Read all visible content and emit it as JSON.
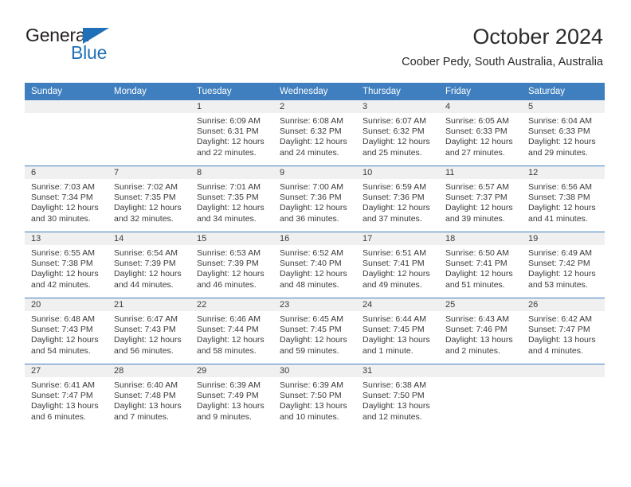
{
  "brand": {
    "name_top": "General",
    "name_bottom": "Blue",
    "accent_color": "#1f70b8"
  },
  "header": {
    "month_title": "October 2024",
    "location": "Coober Pedy, South Australia, Australia"
  },
  "calendar": {
    "header_bg": "#3f7fbf",
    "weekday_headers": [
      "Sunday",
      "Monday",
      "Tuesday",
      "Wednesday",
      "Thursday",
      "Friday",
      "Saturday"
    ],
    "weeks": [
      [
        {
          "day": "",
          "blank": true,
          "sunrise": "",
          "sunset": "",
          "daylight1": "",
          "daylight2": ""
        },
        {
          "day": "",
          "blank": true,
          "sunrise": "",
          "sunset": "",
          "daylight1": "",
          "daylight2": ""
        },
        {
          "day": "1",
          "blank": false,
          "sunrise": "Sunrise: 6:09 AM",
          "sunset": "Sunset: 6:31 PM",
          "daylight1": "Daylight: 12 hours",
          "daylight2": "and 22 minutes."
        },
        {
          "day": "2",
          "blank": false,
          "sunrise": "Sunrise: 6:08 AM",
          "sunset": "Sunset: 6:32 PM",
          "daylight1": "Daylight: 12 hours",
          "daylight2": "and 24 minutes."
        },
        {
          "day": "3",
          "blank": false,
          "sunrise": "Sunrise: 6:07 AM",
          "sunset": "Sunset: 6:32 PM",
          "daylight1": "Daylight: 12 hours",
          "daylight2": "and 25 minutes."
        },
        {
          "day": "4",
          "blank": false,
          "sunrise": "Sunrise: 6:05 AM",
          "sunset": "Sunset: 6:33 PM",
          "daylight1": "Daylight: 12 hours",
          "daylight2": "and 27 minutes."
        },
        {
          "day": "5",
          "blank": false,
          "sunrise": "Sunrise: 6:04 AM",
          "sunset": "Sunset: 6:33 PM",
          "daylight1": "Daylight: 12 hours",
          "daylight2": "and 29 minutes."
        }
      ],
      [
        {
          "day": "6",
          "blank": false,
          "sunrise": "Sunrise: 7:03 AM",
          "sunset": "Sunset: 7:34 PM",
          "daylight1": "Daylight: 12 hours",
          "daylight2": "and 30 minutes."
        },
        {
          "day": "7",
          "blank": false,
          "sunrise": "Sunrise: 7:02 AM",
          "sunset": "Sunset: 7:35 PM",
          "daylight1": "Daylight: 12 hours",
          "daylight2": "and 32 minutes."
        },
        {
          "day": "8",
          "blank": false,
          "sunrise": "Sunrise: 7:01 AM",
          "sunset": "Sunset: 7:35 PM",
          "daylight1": "Daylight: 12 hours",
          "daylight2": "and 34 minutes."
        },
        {
          "day": "9",
          "blank": false,
          "sunrise": "Sunrise: 7:00 AM",
          "sunset": "Sunset: 7:36 PM",
          "daylight1": "Daylight: 12 hours",
          "daylight2": "and 36 minutes."
        },
        {
          "day": "10",
          "blank": false,
          "sunrise": "Sunrise: 6:59 AM",
          "sunset": "Sunset: 7:36 PM",
          "daylight1": "Daylight: 12 hours",
          "daylight2": "and 37 minutes."
        },
        {
          "day": "11",
          "blank": false,
          "sunrise": "Sunrise: 6:57 AM",
          "sunset": "Sunset: 7:37 PM",
          "daylight1": "Daylight: 12 hours",
          "daylight2": "and 39 minutes."
        },
        {
          "day": "12",
          "blank": false,
          "sunrise": "Sunrise: 6:56 AM",
          "sunset": "Sunset: 7:38 PM",
          "daylight1": "Daylight: 12 hours",
          "daylight2": "and 41 minutes."
        }
      ],
      [
        {
          "day": "13",
          "blank": false,
          "sunrise": "Sunrise: 6:55 AM",
          "sunset": "Sunset: 7:38 PM",
          "daylight1": "Daylight: 12 hours",
          "daylight2": "and 42 minutes."
        },
        {
          "day": "14",
          "blank": false,
          "sunrise": "Sunrise: 6:54 AM",
          "sunset": "Sunset: 7:39 PM",
          "daylight1": "Daylight: 12 hours",
          "daylight2": "and 44 minutes."
        },
        {
          "day": "15",
          "blank": false,
          "sunrise": "Sunrise: 6:53 AM",
          "sunset": "Sunset: 7:39 PM",
          "daylight1": "Daylight: 12 hours",
          "daylight2": "and 46 minutes."
        },
        {
          "day": "16",
          "blank": false,
          "sunrise": "Sunrise: 6:52 AM",
          "sunset": "Sunset: 7:40 PM",
          "daylight1": "Daylight: 12 hours",
          "daylight2": "and 48 minutes."
        },
        {
          "day": "17",
          "blank": false,
          "sunrise": "Sunrise: 6:51 AM",
          "sunset": "Sunset: 7:41 PM",
          "daylight1": "Daylight: 12 hours",
          "daylight2": "and 49 minutes."
        },
        {
          "day": "18",
          "blank": false,
          "sunrise": "Sunrise: 6:50 AM",
          "sunset": "Sunset: 7:41 PM",
          "daylight1": "Daylight: 12 hours",
          "daylight2": "and 51 minutes."
        },
        {
          "day": "19",
          "blank": false,
          "sunrise": "Sunrise: 6:49 AM",
          "sunset": "Sunset: 7:42 PM",
          "daylight1": "Daylight: 12 hours",
          "daylight2": "and 53 minutes."
        }
      ],
      [
        {
          "day": "20",
          "blank": false,
          "sunrise": "Sunrise: 6:48 AM",
          "sunset": "Sunset: 7:43 PM",
          "daylight1": "Daylight: 12 hours",
          "daylight2": "and 54 minutes."
        },
        {
          "day": "21",
          "blank": false,
          "sunrise": "Sunrise: 6:47 AM",
          "sunset": "Sunset: 7:43 PM",
          "daylight1": "Daylight: 12 hours",
          "daylight2": "and 56 minutes."
        },
        {
          "day": "22",
          "blank": false,
          "sunrise": "Sunrise: 6:46 AM",
          "sunset": "Sunset: 7:44 PM",
          "daylight1": "Daylight: 12 hours",
          "daylight2": "and 58 minutes."
        },
        {
          "day": "23",
          "blank": false,
          "sunrise": "Sunrise: 6:45 AM",
          "sunset": "Sunset: 7:45 PM",
          "daylight1": "Daylight: 12 hours",
          "daylight2": "and 59 minutes."
        },
        {
          "day": "24",
          "blank": false,
          "sunrise": "Sunrise: 6:44 AM",
          "sunset": "Sunset: 7:45 PM",
          "daylight1": "Daylight: 13 hours",
          "daylight2": "and 1 minute."
        },
        {
          "day": "25",
          "blank": false,
          "sunrise": "Sunrise: 6:43 AM",
          "sunset": "Sunset: 7:46 PM",
          "daylight1": "Daylight: 13 hours",
          "daylight2": "and 2 minutes."
        },
        {
          "day": "26",
          "blank": false,
          "sunrise": "Sunrise: 6:42 AM",
          "sunset": "Sunset: 7:47 PM",
          "daylight1": "Daylight: 13 hours",
          "daylight2": "and 4 minutes."
        }
      ],
      [
        {
          "day": "27",
          "blank": false,
          "sunrise": "Sunrise: 6:41 AM",
          "sunset": "Sunset: 7:47 PM",
          "daylight1": "Daylight: 13 hours",
          "daylight2": "and 6 minutes."
        },
        {
          "day": "28",
          "blank": false,
          "sunrise": "Sunrise: 6:40 AM",
          "sunset": "Sunset: 7:48 PM",
          "daylight1": "Daylight: 13 hours",
          "daylight2": "and 7 minutes."
        },
        {
          "day": "29",
          "blank": false,
          "sunrise": "Sunrise: 6:39 AM",
          "sunset": "Sunset: 7:49 PM",
          "daylight1": "Daylight: 13 hours",
          "daylight2": "and 9 minutes."
        },
        {
          "day": "30",
          "blank": false,
          "sunrise": "Sunrise: 6:39 AM",
          "sunset": "Sunset: 7:50 PM",
          "daylight1": "Daylight: 13 hours",
          "daylight2": "and 10 minutes."
        },
        {
          "day": "31",
          "blank": false,
          "sunrise": "Sunrise: 6:38 AM",
          "sunset": "Sunset: 7:50 PM",
          "daylight1": "Daylight: 13 hours",
          "daylight2": "and 12 minutes."
        },
        {
          "day": "",
          "blank": true,
          "sunrise": "",
          "sunset": "",
          "daylight1": "",
          "daylight2": ""
        },
        {
          "day": "",
          "blank": true,
          "sunrise": "",
          "sunset": "",
          "daylight1": "",
          "daylight2": ""
        }
      ]
    ]
  }
}
